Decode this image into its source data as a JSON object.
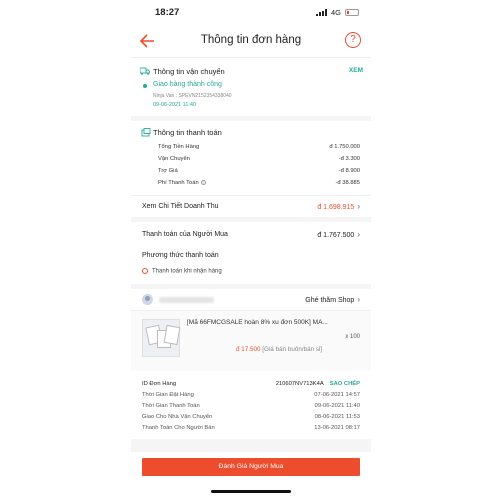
{
  "status_bar": {
    "time": "18:27",
    "network": "4G"
  },
  "header": {
    "title": "Thông tin đơn hàng"
  },
  "shipping": {
    "heading": "Thông tin vận chuyển",
    "link": "XEM",
    "status": "Giao hàng thành công",
    "tracking": "Ninja Van : SPEVN2152354338040",
    "date": "09-06-2021 11:40"
  },
  "payment": {
    "heading": "Thông tin thanh toán",
    "rows": [
      {
        "label": "Tổng Tiền Hàng",
        "value": "đ 1.750.000"
      },
      {
        "label": "Vận Chuyển",
        "value": "-đ 3.300"
      },
      {
        "label": "Trợ Giá",
        "value": "-đ 8.900"
      },
      {
        "label": "Phí Thanh Toán",
        "value": "-đ 38.885"
      }
    ],
    "detail_label": "Xem Chi Tiết Doanh Thu",
    "detail_value": "đ 1.698.915"
  },
  "buyer_payment": {
    "label": "Thanh toán của Người Mua",
    "value": "đ 1.767.500"
  },
  "method": {
    "title": "Phương thức thanh toán",
    "value": "Thanh toán khi nhận hàng"
  },
  "shop": {
    "visit": "Ghé thăm Shop"
  },
  "product": {
    "name": "[Mã 66FMCGSALE hoàn 8% xu đơn 500K] MÃ...",
    "qty": "x 100",
    "price": "đ 17.500",
    "price_note": "[Giá bán buôn/bán sỉ]"
  },
  "order_meta": {
    "id_label": "ID Đơn Hàng",
    "id_value": "210607NV713K4A",
    "copy": "SAO CHÉP",
    "rows": [
      {
        "label": "Thời Gian Đặt Hàng",
        "value": "07-06-2021 14:57"
      },
      {
        "label": "Thời Gian Thanh Toán",
        "value": "09-06-2021 11:40"
      },
      {
        "label": "Giao Cho Nhà Vận Chuyển",
        "value": "08-06-2021 11:53"
      },
      {
        "label": "Thanh Toán Cho Người Bán",
        "value": "13-06-2021 08:17"
      }
    ]
  },
  "actions": {
    "rate_buyer": "Đánh Giá Người Mua"
  }
}
